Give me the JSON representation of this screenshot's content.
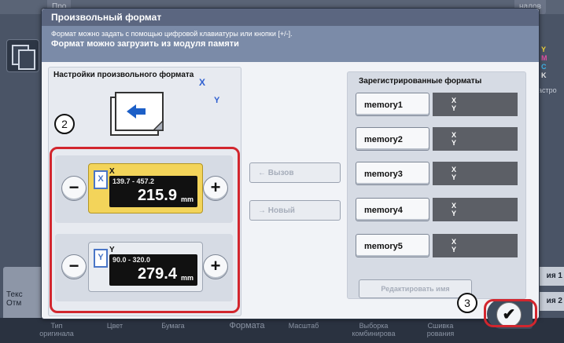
{
  "background": {
    "tabs": [
      "Про",
      "налов"
    ],
    "right_letters": [
      "Y",
      "M",
      "C",
      "K"
    ],
    "right_label": "астро",
    "right_buttons": [
      "ия 1",
      "ия 2"
    ],
    "left_button": [
      "Текс",
      "Отм"
    ],
    "bottom_tabs": [
      "Тип оригинала",
      "Цвет",
      "Бумага",
      "Формата",
      "Масштаб",
      "Выборка комбинирова",
      "Сшивка рования"
    ]
  },
  "dialog": {
    "title": "Произвольный формат",
    "message_line1": "Формат можно задать с помощью цифровой клавиатуры или кнопки [+/-].",
    "message_line2": "Формат можно загрузить из модуля памяти"
  },
  "custom": {
    "title": "Настройки произвольного формата",
    "x_label": "X",
    "y_label": "Y",
    "x": {
      "axis": "X",
      "range": "139.7 - 457.2",
      "value": "215.9",
      "unit": "mm"
    },
    "y": {
      "axis": "Y",
      "range": "90.0 - 320.0",
      "value": "279.4",
      "unit": "mm"
    }
  },
  "middle": {
    "recall_label": "← Вызов",
    "new_label": "→ Новый"
  },
  "registered": {
    "title": "Зарегистрированные форматы",
    "items": [
      {
        "label": "memory1",
        "x": "X",
        "y": "Y"
      },
      {
        "label": "memory2",
        "x": "X",
        "y": "Y"
      },
      {
        "label": "memory3",
        "x": "X",
        "y": "Y"
      },
      {
        "label": "memory4",
        "x": "X",
        "y": "Y"
      },
      {
        "label": "memory5",
        "x": "X",
        "y": "Y"
      }
    ],
    "rename_label": "Редактировать имя"
  },
  "steps": {
    "two": "2",
    "three": "3"
  },
  "ok": {
    "glyph": "✔"
  },
  "colors": {
    "active": "#f3d45a",
    "highlight": "#d2262e",
    "header": "#5b6680"
  }
}
